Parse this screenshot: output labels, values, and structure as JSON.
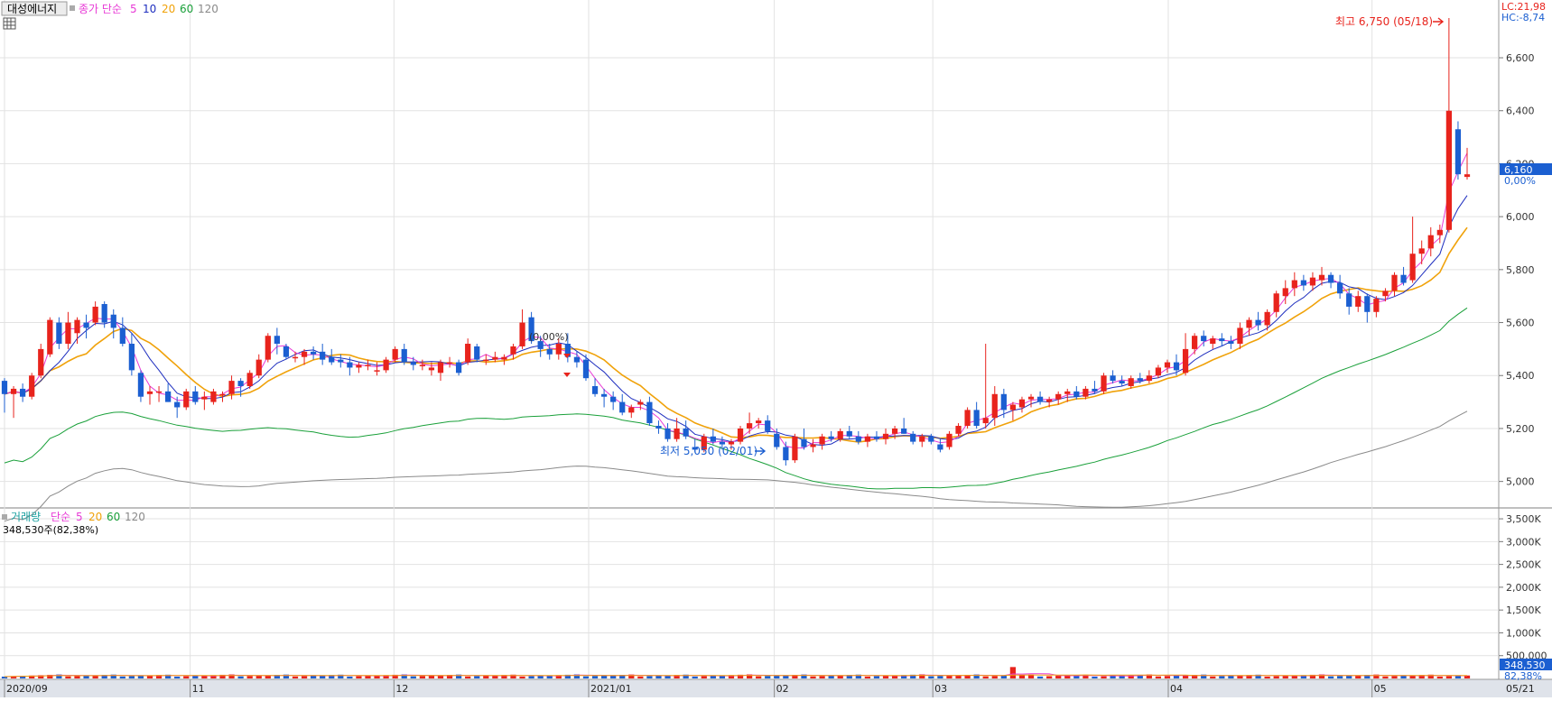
{
  "stock_name": "대성에너지",
  "legend_top": {
    "label": "종가 단순",
    "periods": [
      "5",
      "10",
      "20",
      "60",
      "120"
    ]
  },
  "legend_bottom": {
    "label": "거래량",
    "sublabel": "단순",
    "periods": [
      "5",
      "20",
      "60",
      "120"
    ]
  },
  "volume_info": "348,530주(82,38%)",
  "lc_label": "LC:21,98",
  "hc_label": "HC:-8,74",
  "last_price_tag": "6,160",
  "change_tag": "0,00%",
  "volume_tag": "348,530",
  "volume_pct_tag": "82,38%",
  "high_label": "최고 6,750 (05/18)",
  "low_label": "최저 5,050 (02/01)",
  "mid_label": "(0,00%)",
  "x_ticks": [
    "2020/09",
    "11",
    "12",
    "2021/01",
    "02",
    "03",
    "04",
    "05",
    "05/21"
  ],
  "price_ticks": [
    "6,600",
    "6,400",
    "6,200",
    "6,000",
    "5,800",
    "5,600",
    "5,400",
    "5,200",
    "5,000"
  ],
  "volume_ticks": [
    "3,500K",
    "3,000K",
    "2,500K",
    "2,000K",
    "1,500K",
    "1,000K",
    "500,000"
  ],
  "colors": {
    "up": "#e8231c",
    "down": "#1b5fd1",
    "ma5": "#e83ad6",
    "ma10": "#1f2fbf",
    "ma20": "#f0a20a",
    "ma60": "#1aa03a",
    "ma120": "#8a8a8a",
    "grid": "#e2e2e2"
  },
  "chart_data": {
    "type": "candlestick",
    "x_range": [
      "2020/09",
      "2021/05/21"
    ],
    "ylim_price": [
      4900,
      6750
    ],
    "ylim_volume": [
      0,
      3600000
    ],
    "highest": {
      "value": 6750,
      "date": "05/18"
    },
    "lowest": {
      "value": 5050,
      "date": "02/01"
    },
    "last_close": 6160,
    "last_volume": 348530,
    "candles": [
      [
        5380,
        5390,
        5260,
        5330
      ],
      [
        5330,
        5360,
        5240,
        5350
      ],
      [
        5350,
        5370,
        5300,
        5320
      ],
      [
        5320,
        5410,
        5310,
        5400
      ],
      [
        5400,
        5520,
        5390,
        5500
      ],
      [
        5480,
        5620,
        5470,
        5610
      ],
      [
        5600,
        5620,
        5500,
        5520
      ],
      [
        5520,
        5640,
        5500,
        5600
      ],
      [
        5560,
        5620,
        5520,
        5610
      ],
      [
        5600,
        5630,
        5540,
        5580
      ],
      [
        5600,
        5680,
        5590,
        5660
      ],
      [
        5670,
        5680,
        5580,
        5600
      ],
      [
        5630,
        5650,
        5540,
        5580
      ],
      [
        5580,
        5620,
        5510,
        5520
      ],
      [
        5520,
        5560,
        5400,
        5420
      ],
      [
        5410,
        5420,
        5300,
        5320
      ],
      [
        5330,
        5360,
        5290,
        5340
      ],
      [
        5340,
        5360,
        5300,
        5340
      ],
      [
        5340,
        5370,
        5300,
        5300
      ],
      [
        5300,
        5320,
        5240,
        5280
      ],
      [
        5280,
        5350,
        5270,
        5340
      ],
      [
        5340,
        5360,
        5290,
        5300
      ],
      [
        5310,
        5340,
        5270,
        5320
      ],
      [
        5300,
        5350,
        5290,
        5340
      ],
      [
        5330,
        5340,
        5300,
        5330
      ],
      [
        5330,
        5400,
        5310,
        5380
      ],
      [
        5380,
        5390,
        5320,
        5360
      ],
      [
        5360,
        5420,
        5350,
        5410
      ],
      [
        5400,
        5480,
        5390,
        5460
      ],
      [
        5460,
        5560,
        5450,
        5550
      ],
      [
        5550,
        5580,
        5480,
        5520
      ],
      [
        5510,
        5520,
        5460,
        5470
      ],
      [
        5470,
        5490,
        5450,
        5470
      ],
      [
        5470,
        5500,
        5440,
        5490
      ],
      [
        5490,
        5510,
        5460,
        5480
      ],
      [
        5490,
        5520,
        5440,
        5460
      ],
      [
        5470,
        5500,
        5440,
        5450
      ],
      [
        5460,
        5480,
        5430,
        5450
      ],
      [
        5450,
        5470,
        5400,
        5430
      ],
      [
        5430,
        5450,
        5410,
        5440
      ],
      [
        5440,
        5460,
        5420,
        5440
      ],
      [
        5420,
        5450,
        5400,
        5420
      ],
      [
        5420,
        5470,
        5410,
        5460
      ],
      [
        5460,
        5510,
        5450,
        5500
      ],
      [
        5500,
        5520,
        5440,
        5450
      ],
      [
        5450,
        5470,
        5420,
        5440
      ],
      [
        5440,
        5460,
        5420,
        5440
      ],
      [
        5420,
        5450,
        5400,
        5430
      ],
      [
        5410,
        5460,
        5380,
        5450
      ],
      [
        5450,
        5470,
        5430,
        5450
      ],
      [
        5450,
        5460,
        5400,
        5410
      ],
      [
        5450,
        5540,
        5440,
        5520
      ],
      [
        5510,
        5520,
        5450,
        5460
      ],
      [
        5460,
        5480,
        5440,
        5460
      ],
      [
        5460,
        5490,
        5450,
        5470
      ],
      [
        5460,
        5480,
        5440,
        5470
      ],
      [
        5480,
        5520,
        5460,
        5510
      ],
      [
        5510,
        5650,
        5500,
        5600
      ],
      [
        5620,
        5640,
        5520,
        5530
      ],
      [
        5530,
        5550,
        5470,
        5500
      ],
      [
        5500,
        5520,
        5460,
        5480
      ],
      [
        5480,
        5540,
        5460,
        5520
      ],
      [
        5520,
        5560,
        5450,
        5470
      ],
      [
        5470,
        5490,
        5430,
        5450
      ],
      [
        5460,
        5480,
        5380,
        5390
      ],
      [
        5360,
        5390,
        5320,
        5330
      ],
      [
        5330,
        5350,
        5280,
        5320
      ],
      [
        5320,
        5340,
        5270,
        5300
      ],
      [
        5300,
        5330,
        5250,
        5260
      ],
      [
        5260,
        5290,
        5240,
        5280
      ],
      [
        5290,
        5310,
        5270,
        5300
      ],
      [
        5300,
        5320,
        5210,
        5220
      ],
      [
        5210,
        5230,
        5180,
        5200
      ],
      [
        5200,
        5220,
        5150,
        5160
      ],
      [
        5160,
        5240,
        5150,
        5200
      ],
      [
        5200,
        5230,
        5160,
        5170
      ],
      [
        5130,
        5160,
        5110,
        5120
      ],
      [
        5120,
        5180,
        5110,
        5170
      ],
      [
        5170,
        5200,
        5140,
        5150
      ],
      [
        5150,
        5170,
        5120,
        5140
      ],
      [
        5140,
        5160,
        5120,
        5150
      ],
      [
        5150,
        5210,
        5140,
        5200
      ],
      [
        5200,
        5260,
        5180,
        5220
      ],
      [
        5220,
        5240,
        5200,
        5230
      ],
      [
        5230,
        5250,
        5180,
        5190
      ],
      [
        5180,
        5200,
        5120,
        5130
      ],
      [
        5130,
        5150,
        5060,
        5080
      ],
      [
        5080,
        5180,
        5070,
        5170
      ],
      [
        5160,
        5200,
        5120,
        5130
      ],
      [
        5130,
        5160,
        5110,
        5140
      ],
      [
        5140,
        5180,
        5120,
        5170
      ],
      [
        5170,
        5190,
        5150,
        5160
      ],
      [
        5160,
        5200,
        5150,
        5190
      ],
      [
        5190,
        5210,
        5160,
        5170
      ],
      [
        5170,
        5190,
        5140,
        5150
      ],
      [
        5150,
        5180,
        5130,
        5170
      ],
      [
        5170,
        5190,
        5150,
        5160
      ],
      [
        5160,
        5200,
        5140,
        5180
      ],
      [
        5180,
        5210,
        5160,
        5200
      ],
      [
        5200,
        5240,
        5180,
        5180
      ],
      [
        5180,
        5190,
        5140,
        5150
      ],
      [
        5150,
        5180,
        5130,
        5170
      ],
      [
        5170,
        5180,
        5140,
        5150
      ],
      [
        5140,
        5160,
        5110,
        5120
      ],
      [
        5130,
        5190,
        5120,
        5180
      ],
      [
        5180,
        5220,
        5170,
        5210
      ],
      [
        5210,
        5280,
        5200,
        5270
      ],
      [
        5270,
        5300,
        5200,
        5210
      ],
      [
        5220,
        5520,
        5200,
        5240
      ],
      [
        5240,
        5360,
        5210,
        5330
      ],
      [
        5330,
        5350,
        5240,
        5270
      ],
      [
        5270,
        5300,
        5230,
        5290
      ],
      [
        5280,
        5320,
        5260,
        5310
      ],
      [
        5310,
        5330,
        5280,
        5320
      ],
      [
        5320,
        5340,
        5290,
        5300
      ],
      [
        5300,
        5320,
        5280,
        5310
      ],
      [
        5310,
        5340,
        5290,
        5330
      ],
      [
        5330,
        5350,
        5300,
        5340
      ],
      [
        5340,
        5360,
        5310,
        5320
      ],
      [
        5320,
        5360,
        5310,
        5350
      ],
      [
        5350,
        5380,
        5330,
        5340
      ],
      [
        5340,
        5410,
        5330,
        5400
      ],
      [
        5400,
        5420,
        5370,
        5380
      ],
      [
        5380,
        5400,
        5360,
        5370
      ],
      [
        5360,
        5400,
        5350,
        5390
      ],
      [
        5390,
        5410,
        5370,
        5380
      ],
      [
        5380,
        5420,
        5370,
        5400
      ],
      [
        5400,
        5440,
        5390,
        5430
      ],
      [
        5430,
        5460,
        5410,
        5450
      ],
      [
        5450,
        5480,
        5400,
        5420
      ],
      [
        5410,
        5560,
        5400,
        5500
      ],
      [
        5500,
        5560,
        5480,
        5550
      ],
      [
        5550,
        5570,
        5510,
        5530
      ],
      [
        5520,
        5550,
        5500,
        5540
      ],
      [
        5540,
        5560,
        5510,
        5530
      ],
      [
        5530,
        5550,
        5500,
        5520
      ],
      [
        5520,
        5600,
        5500,
        5580
      ],
      [
        5580,
        5620,
        5550,
        5610
      ],
      [
        5610,
        5640,
        5570,
        5590
      ],
      [
        5590,
        5650,
        5570,
        5640
      ],
      [
        5640,
        5720,
        5620,
        5710
      ],
      [
        5700,
        5760,
        5670,
        5730
      ],
      [
        5730,
        5790,
        5700,
        5760
      ],
      [
        5760,
        5780,
        5720,
        5740
      ],
      [
        5740,
        5790,
        5720,
        5770
      ],
      [
        5760,
        5810,
        5740,
        5780
      ],
      [
        5780,
        5790,
        5730,
        5750
      ],
      [
        5750,
        5780,
        5690,
        5710
      ],
      [
        5710,
        5730,
        5630,
        5660
      ],
      [
        5660,
        5720,
        5640,
        5700
      ],
      [
        5700,
        5710,
        5600,
        5640
      ],
      [
        5640,
        5700,
        5620,
        5690
      ],
      [
        5700,
        5730,
        5680,
        5720
      ],
      [
        5720,
        5790,
        5700,
        5780
      ],
      [
        5780,
        5810,
        5740,
        5750
      ],
      [
        5760,
        6000,
        5750,
        5860
      ],
      [
        5860,
        5910,
        5820,
        5880
      ],
      [
        5880,
        5960,
        5850,
        5930
      ],
      [
        5930,
        5970,
        5900,
        5950
      ],
      [
        5950,
        6750,
        5940,
        6400
      ],
      [
        6330,
        6360,
        6140,
        6160
      ],
      [
        6150,
        6260,
        6140,
        6160
      ]
    ],
    "volume_series_approx": {
      "peak_value": 3550000,
      "peak_date": "05/18"
    }
  }
}
